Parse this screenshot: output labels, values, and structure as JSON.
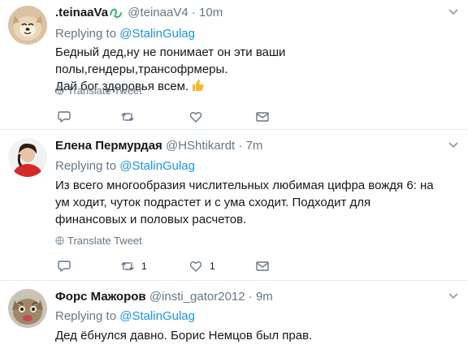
{
  "tweets": [
    {
      "name": ".teinaaVa",
      "handle": "@teinaaV4",
      "sep": "·",
      "time": "10m",
      "reply_prefix": "Replying to",
      "reply_to": "@StalinGulag",
      "text_line1": "Бедный дед,ну не понимает он эти ваши полы,гендеры,трансофрмеры.",
      "text_line2": "Дай бог здоровья всем.",
      "translate": "Translate Tweet",
      "icons": [
        "reply-icon",
        "retweet-icon",
        "like-icon",
        "message-icon"
      ]
    },
    {
      "name": "Елена Пермурдая",
      "handle": "@HShtikardt",
      "sep": "·",
      "time": "7m",
      "reply_prefix": "Replying to",
      "reply_to": "@StalinGulag",
      "text": "Из всего многообразия числительных любимая цифра вождя 6: на ум ходит, чуток подрастет и с ума сходит. Подходит для финансовых и половых расчетов.",
      "translate": "Translate Tweet",
      "retweet_count": "1",
      "like_count": "1",
      "icons": [
        "reply-icon",
        "retweet-icon",
        "like-icon",
        "message-icon"
      ]
    },
    {
      "name": "Форс Мажоров",
      "handle": "@insti_gator2012",
      "sep": "·",
      "time": "9m",
      "reply_prefix": "Replying to",
      "reply_to": "@StalinGulag",
      "text": "Дед ёбнулся давно. Борис Немцов был прав."
    }
  ],
  "colors": {
    "link": "#1b95e0",
    "muted": "#657786",
    "text": "#14171a",
    "divider": "#e6ecf0",
    "like_emoji": "#f5b82e",
    "name_icon": "#3cb371"
  }
}
